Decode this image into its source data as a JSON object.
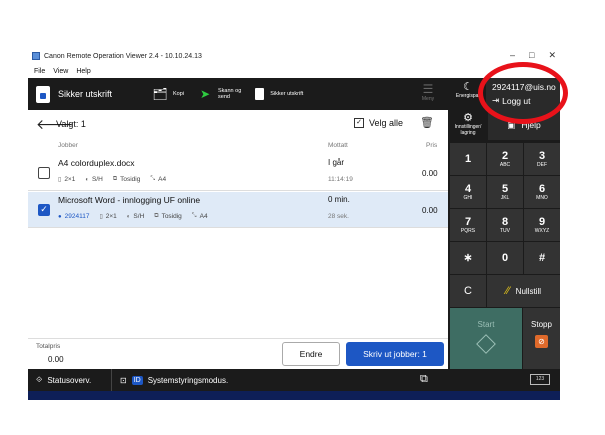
{
  "window": {
    "title": "Canon Remote Operation Viewer 2.4 - 10.10.24.13",
    "menus": [
      "File",
      "View",
      "Help"
    ],
    "controls": [
      "–",
      "□",
      "✕"
    ]
  },
  "toolbar": {
    "main_label": "Sikker utskrift",
    "items": [
      {
        "label": "Kopi",
        "icon": "copy-icon"
      },
      {
        "label": "Skann og\nsend",
        "icon": "scan-send-icon"
      },
      {
        "label": "Sikker utskrift",
        "icon": "secure-print-icon"
      }
    ],
    "menu_label": "Meny"
  },
  "header_right": {
    "energy_label": "Energispar",
    "user_id": "2924117@uis.no",
    "logout_label": "Logg ut"
  },
  "selection": {
    "selected_label": "Valgt: 1",
    "select_all_label": "Velg alle"
  },
  "columns": {
    "jobs": "Jobber",
    "received": "Mottatt",
    "price": "Pris"
  },
  "jobs": [
    {
      "name": "A4 colorduplex.docx",
      "checked": false,
      "attrs": [
        "2×1",
        "S/H",
        "Tosidig",
        "A4"
      ],
      "received": "I går",
      "received_time": "11:14:19",
      "price": "0.00"
    },
    {
      "name": "Microsoft Word - innlogging UF online",
      "checked": true,
      "user": "2924117",
      "attrs": [
        "2×1",
        "S/H",
        "Tosidig",
        "A4"
      ],
      "received": "0 min.",
      "received_time": "28 sek.",
      "price": "0.00"
    }
  ],
  "footer": {
    "total_label": "Totalpris",
    "total_value": "0.00",
    "edit_label": "Endre",
    "print_label": "Skriv ut jobber: 1"
  },
  "statusbar": {
    "status_label": "Statusoverv.",
    "id_badge": "ID",
    "system_label": "Systemstyringsmodus.",
    "keyboard_label": "123"
  },
  "keypad": {
    "settings_label": "Innstillinger/\nlagring",
    "help_label": "Hjelp",
    "keys": [
      {
        "d": "1",
        "l": ""
      },
      {
        "d": "2",
        "l": "ABC"
      },
      {
        "d": "3",
        "l": "DEF"
      },
      {
        "d": "4",
        "l": "GHI"
      },
      {
        "d": "5",
        "l": "JKL"
      },
      {
        "d": "6",
        "l": "MNO"
      },
      {
        "d": "7",
        "l": "PQRS"
      },
      {
        "d": "8",
        "l": "TUV"
      },
      {
        "d": "9",
        "l": "WXYZ"
      },
      {
        "d": "∗",
        "l": ""
      },
      {
        "d": "0",
        "l": ""
      },
      {
        "d": "#",
        "l": ""
      }
    ],
    "clear_label": "C",
    "reset_label": "Nullstill",
    "start_label": "Start",
    "stop_label": "Stopp"
  },
  "colors": {
    "accent": "#1d57c4",
    "highlight_circle": "#e8121a",
    "start_green": "#3e6d63",
    "stop_orange": "#e06a2b"
  }
}
